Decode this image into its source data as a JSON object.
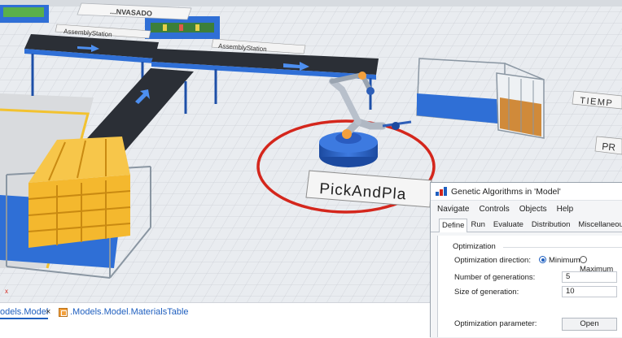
{
  "scene": {
    "banner_text": "...NVASADO",
    "labels": {
      "assembly_station_1": "AssemblyStation",
      "assembly_station_2": "AssemblyStation",
      "pick_and_place": "PickAndPla",
      "tiempo": "TIEMP",
      "pr": "PR"
    },
    "colors": {
      "conveyor": "#2b2f36",
      "table_blue": "#2f6fd6",
      "robot_blue": "#2e5fb8",
      "zone_red": "#d4261c",
      "pallet_yellow": "#f4b82e"
    }
  },
  "doc_tabs": {
    "active_label": "odels.Model",
    "close_glyph": "×",
    "second_label": ".Models.Model.MaterialsTable",
    "second_icon": "table-icon"
  },
  "dialog": {
    "title": "Genetic Algorithms in 'Model'",
    "icon": "app-logo-icon",
    "menu": [
      "Navigate",
      "Controls",
      "Objects",
      "Help"
    ],
    "tabs": [
      "Define",
      "Run",
      "Evaluate",
      "Distribution",
      "Miscellaneous"
    ],
    "selected_tab": "Define",
    "group_label": "Optimization",
    "direction_label": "Optimization direction:",
    "direction_options": [
      "Minimum",
      "Maximum"
    ],
    "direction_selected": "Minimum",
    "generations_label": "Number of generations:",
    "generations_value": "5",
    "size_label": "Size of generation:",
    "size_value": "10",
    "param_label": "Optimization parameter:",
    "open_button": "Open"
  }
}
